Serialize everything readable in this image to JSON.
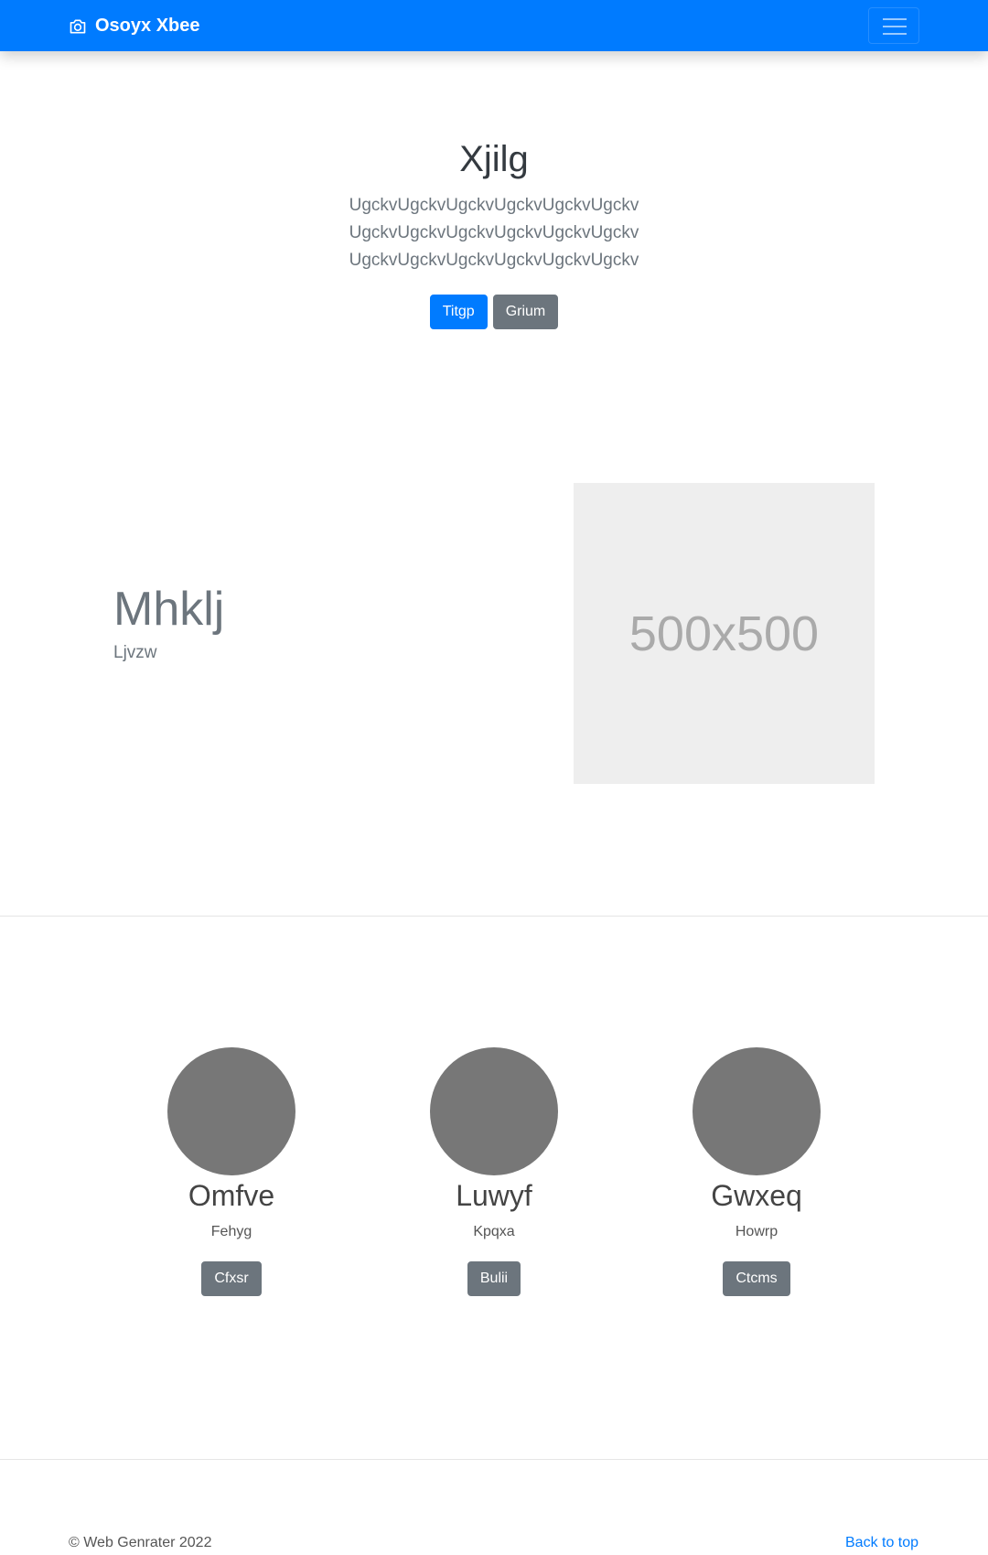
{
  "navbar": {
    "brand": "Osoyx Xbee",
    "brand_icon": "camera-icon",
    "toggler_icon": "hamburger-icon",
    "color": "#007bff"
  },
  "hero": {
    "title": "Xjilg",
    "lead": "UgckvUgckvUgckvUgckvUgckvUgckvUgckvUgckvUgckvUgckvUgckvUgckvUgckvUgckvUgckvUgckvUgckvUgckv",
    "primary_button": "Titgp",
    "secondary_button": "Grium"
  },
  "feature": {
    "heading": "Mhklj",
    "subheading": "Ljvzw",
    "image_placeholder": "500x500"
  },
  "people": [
    {
      "name": "Omfve",
      "desc": "Fehyg",
      "button": "Cfxsr"
    },
    {
      "name": "Luwyf",
      "desc": "Kpqxa",
      "button": "Bulii"
    },
    {
      "name": "Gwxeq",
      "desc": "Howrp",
      "button": "Ctcms"
    }
  ],
  "footer": {
    "copyright": "© Web Genrater 2022",
    "back_to_top": "Back to top"
  }
}
